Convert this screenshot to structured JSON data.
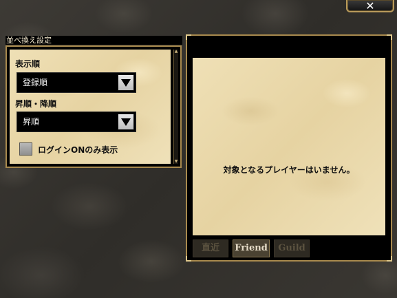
{
  "close_button": {
    "label": "✕"
  },
  "sort_panel": {
    "title": "並べ換え設定",
    "display_order_label": "表示順",
    "display_order_value": "登録順",
    "asc_desc_label": "昇順・降順",
    "asc_desc_value": "昇順",
    "login_only_label": "ログインONのみ表示",
    "login_only_checked": false
  },
  "friend_panel": {
    "empty_message": "対象となるプレイヤーはいません。",
    "tabs": [
      {
        "label": "直近",
        "active": false
      },
      {
        "label": "Friend",
        "active": true
      },
      {
        "label": "Guild",
        "active": false
      }
    ]
  }
}
